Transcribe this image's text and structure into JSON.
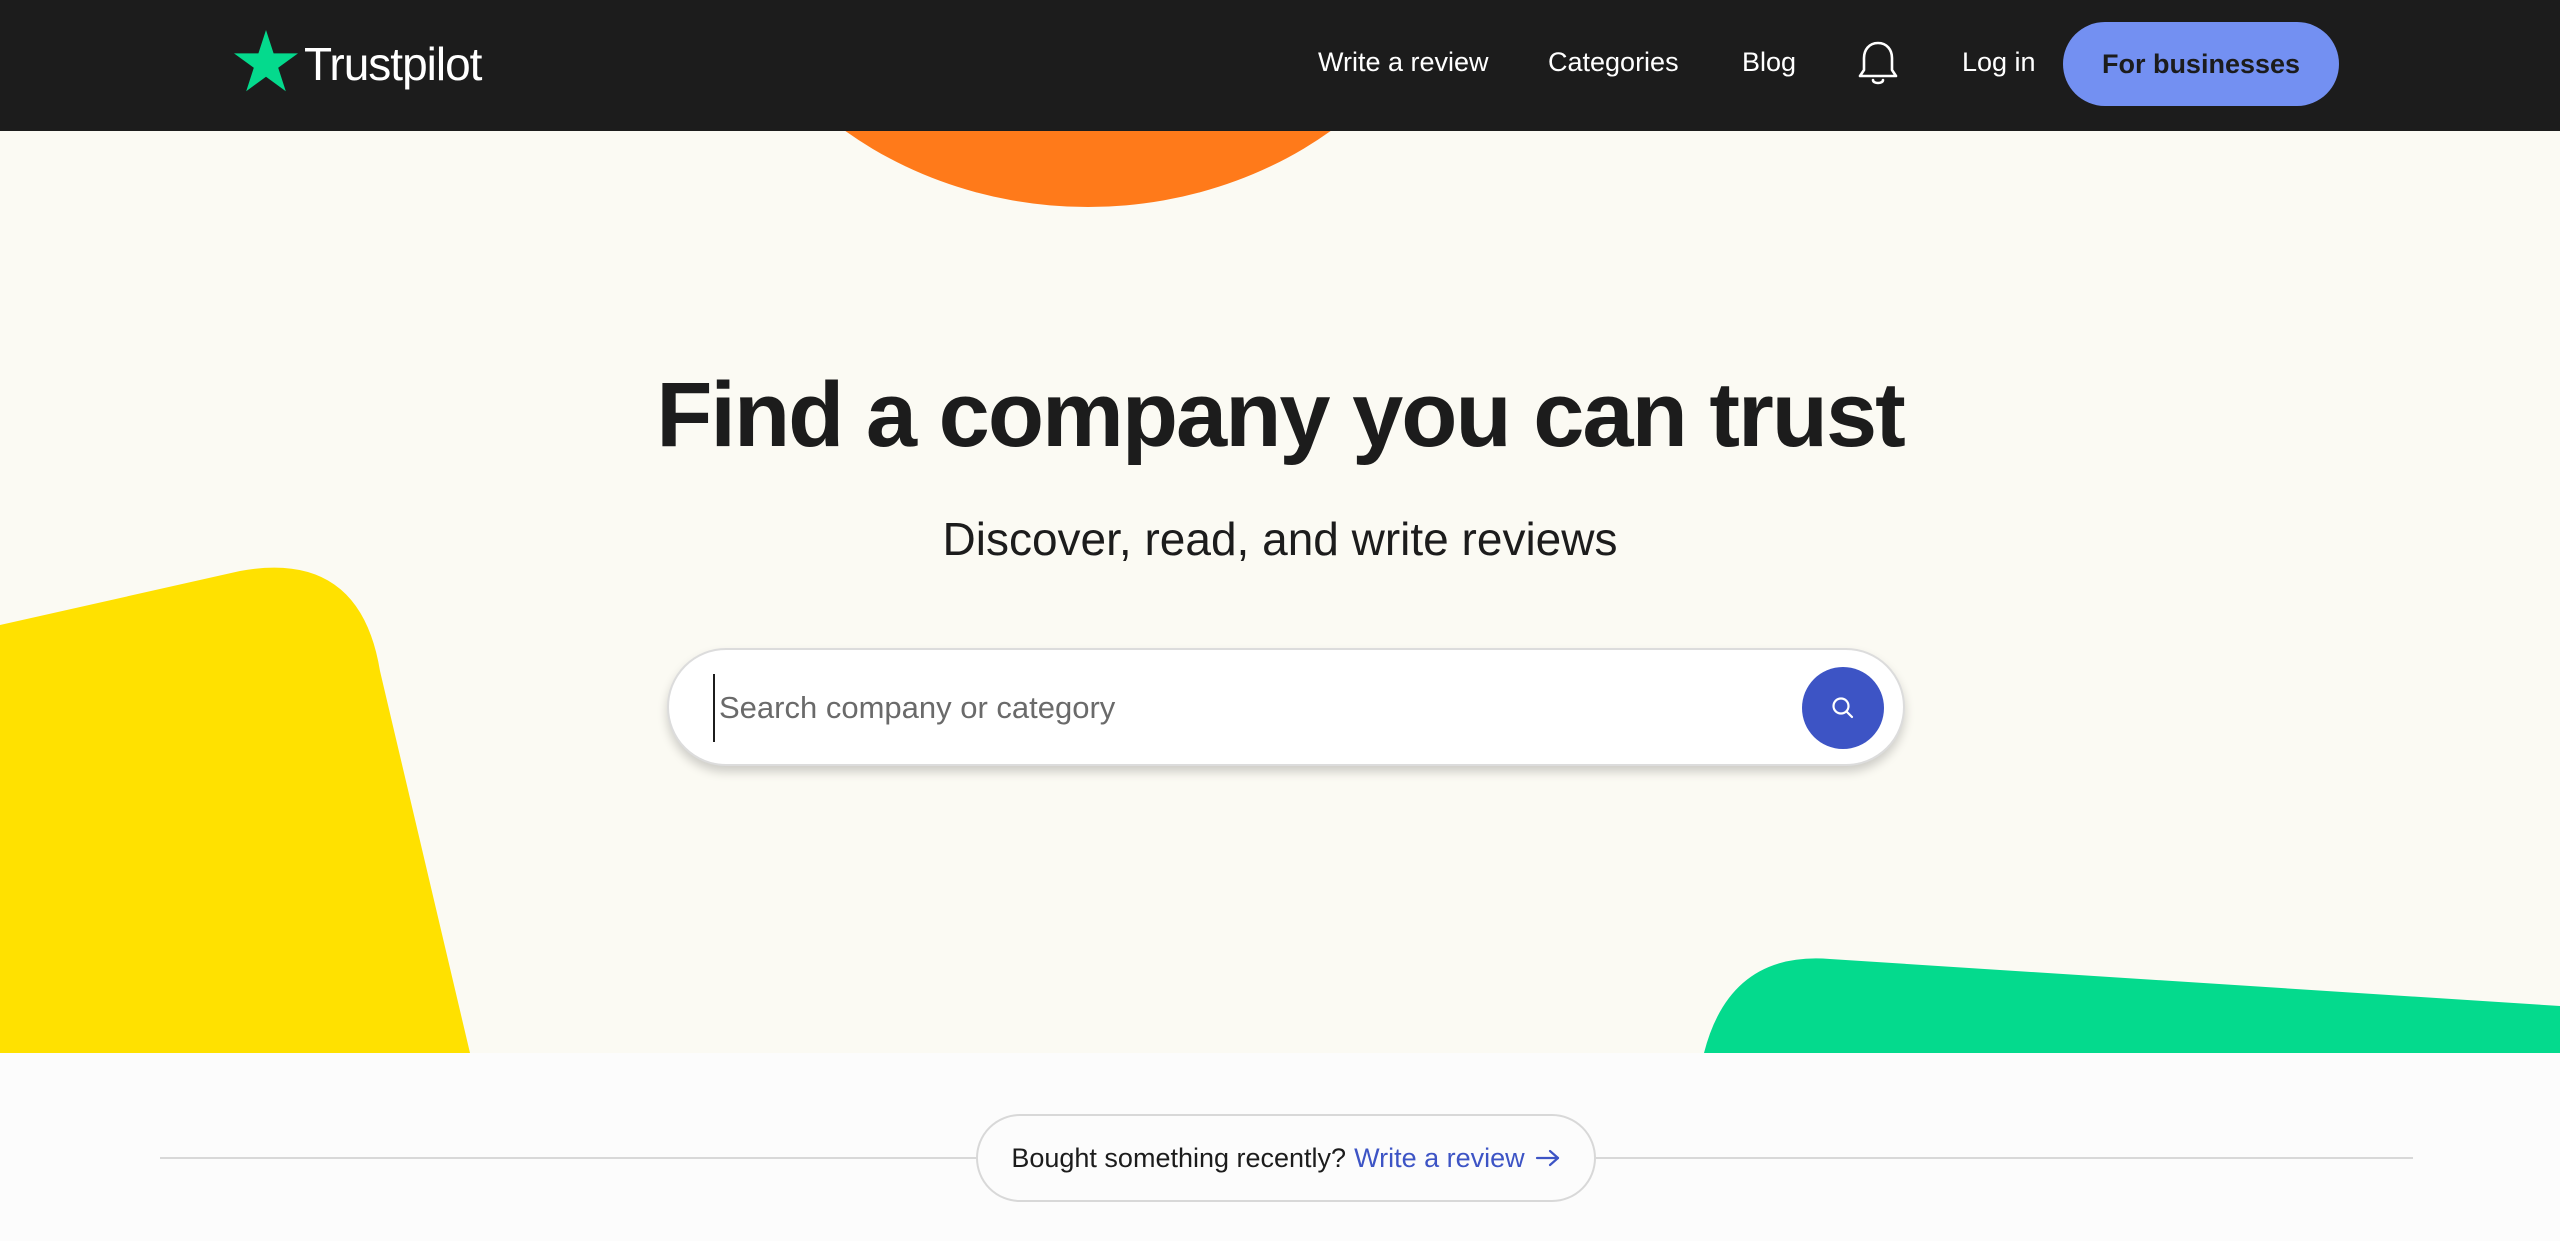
{
  "header": {
    "logo_text": "Trustpilot",
    "nav": {
      "write_review": "Write a review",
      "categories": "Categories",
      "blog": "Blog",
      "login": "Log in",
      "for_businesses": "For businesses"
    },
    "notifications_icon": "bell-icon"
  },
  "hero": {
    "title": "Find a company you can trust",
    "subtitle": "Discover, read, and write reviews",
    "search": {
      "placeholder": "Search company or category",
      "value": "",
      "button_icon": "search-icon"
    }
  },
  "cta": {
    "text": "Bought something recently?",
    "link": "Write a review",
    "link_icon": "arrow-right-icon"
  },
  "colors": {
    "header_bg": "#1c1c1c",
    "brand_green": "#04da8d",
    "business_button": "#7390f2",
    "search_button": "#3d54c5",
    "hero_bg": "#fbfaf3",
    "shape_orange": "#ff7a1a",
    "shape_yellow": "#ffe100",
    "shape_green": "#04da8d"
  }
}
